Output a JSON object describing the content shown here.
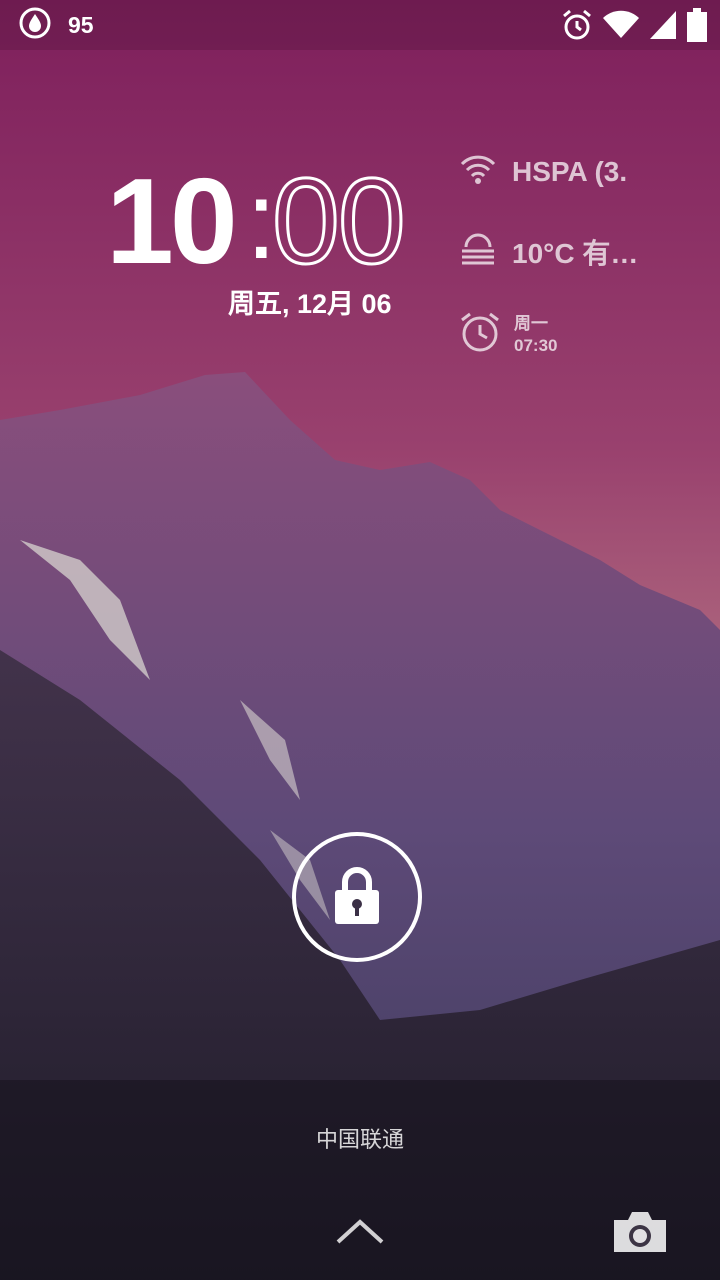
{
  "status_bar": {
    "left_icon": "water-drop-badge-icon",
    "left_count": "95",
    "right_icons": [
      "alarm-clock-icon",
      "wifi-icon",
      "cell-signal-icon",
      "battery-icon"
    ]
  },
  "clock": {
    "hours": "10",
    "separator": ":",
    "minutes": "00",
    "date": "周五, 12月 06"
  },
  "widgets": {
    "network": {
      "icon": "wifi-icon",
      "text": "HSPA (3."
    },
    "weather": {
      "icon": "fog-icon",
      "text": "10°C 有…"
    },
    "alarm": {
      "icon": "alarm-clock-icon",
      "day": "周一",
      "time": "07:30"
    }
  },
  "lock_icon": "padlock-icon",
  "carrier": "中国联通",
  "bottom": {
    "swipe_icon": "chevron-up-icon",
    "camera_icon": "camera-icon"
  },
  "colors": {
    "sky_top": "#8a2a62",
    "sky_bottom": "#b0687a",
    "mountain": "#6a4a7a"
  }
}
